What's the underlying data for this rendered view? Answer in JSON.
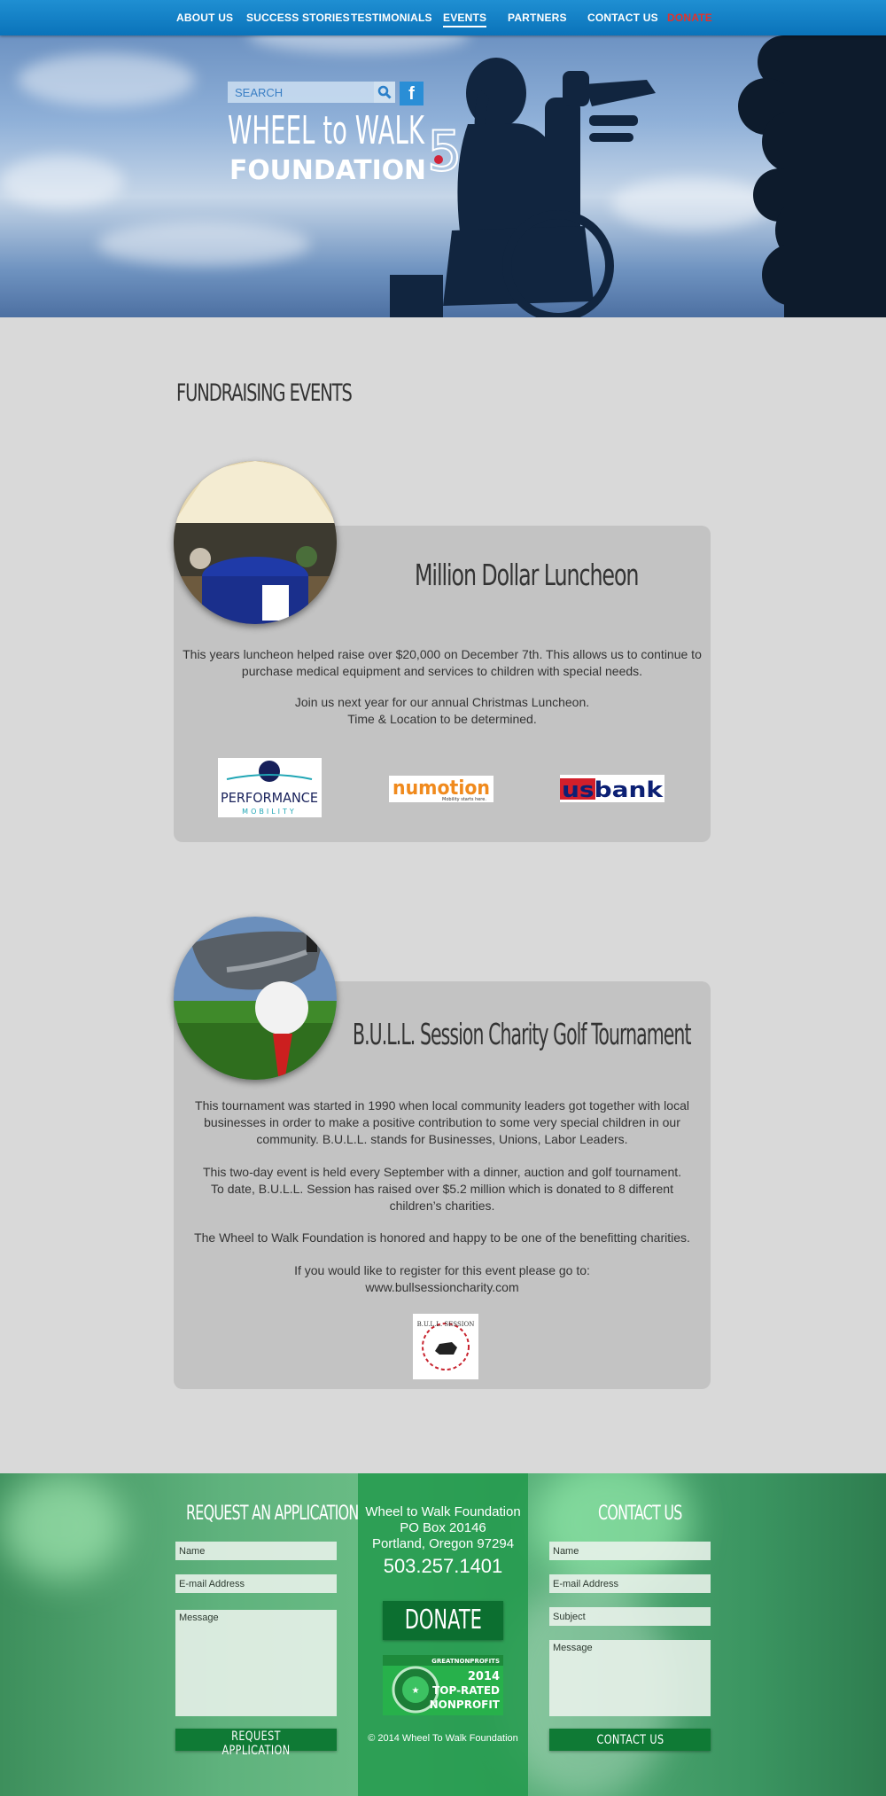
{
  "nav": {
    "items": [
      {
        "label": "ABOUT US"
      },
      {
        "label": "SUCCESS STORIES"
      },
      {
        "label": "TESTIMONIALS"
      },
      {
        "label": "EVENTS"
      },
      {
        "label": "PARTNERS"
      },
      {
        "label": "CONTACT US"
      },
      {
        "label": "DONATE"
      }
    ],
    "active": "EVENTS"
  },
  "header": {
    "search_placeholder": "SEARCH",
    "facebook_label": "f",
    "logo": {
      "line1": "WHEEL to WALK",
      "line2": "FOUNDATION",
      "mark": "5"
    }
  },
  "main": {
    "section_title": "FUNDRAISING EVENTS",
    "events": [
      {
        "title": "Million Dollar Luncheon",
        "paragraphs": [
          [
            "This years luncheon helped raise over $20,000 on December 7th. This allows us to continue to",
            "purchase medical equipment and services to children with special needs."
          ],
          [
            "Join us next year for our annual Christmas Luncheon.",
            "Time & Location to be determined."
          ]
        ],
        "sponsors": [
          {
            "name": "PERFORMANCE",
            "sub": "MOBILITY"
          },
          {
            "name": "numotion",
            "sub": "Mobility starts here."
          },
          {
            "name": "usbank"
          }
        ]
      },
      {
        "title": "B.U.L.L. Session Charity Golf Tournament",
        "paragraphs": [
          [
            "This tournament was started in 1990 when local community leaders got together with local",
            "businesses in order to make a positive contribution to some very special children in our",
            "community. B.U.L.L. stands for Businesses, Unions, Labor Leaders."
          ],
          [
            "This two-day event is held every September with a dinner, auction and golf tournament.",
            "To date, B.U.L.L. Session has raised over $5.2 million which is donated to 8 different",
            "children’s charities."
          ],
          [
            "The Wheel to Walk Foundation is honored and happy to be one of the benefitting charities."
          ],
          [
            "If you would like to register for this event please go to:",
            "www.bullsessioncharity.com"
          ]
        ],
        "sponsor": {
          "name": "B.U.L.L. SESSION"
        }
      }
    ]
  },
  "footer": {
    "request": {
      "heading": "REQUEST AN APPLICATION",
      "name_placeholder": "Name",
      "email_placeholder": "E-mail Address",
      "message_placeholder": "Message",
      "button": "REQUEST APPLICATION"
    },
    "center": {
      "org": "Wheel to Walk Foundation",
      "po_box": "PO Box 20146",
      "city": "Portland, Oregon 97294",
      "phone": "503.257.1401",
      "donate": "DONATE",
      "badge": {
        "brand": "GREATNONPROFITS",
        "year": "2014",
        "line1": "TOP-RATED",
        "line2": "NONPROFIT"
      },
      "copyright": "© 2014 Wheel To Walk Foundation"
    },
    "contact": {
      "heading": "CONTACT US",
      "name_placeholder": "Name",
      "email_placeholder": "E-mail Address",
      "subject_placeholder": "Subject",
      "message_placeholder": "Message",
      "button": "CONTACT US"
    }
  },
  "colors": {
    "nav_bar": "#1582c8",
    "donate_red": "#e4322b",
    "card_bg": "#c3c3c3",
    "page_bg": "#d9d9d9",
    "footer_green": "#20984b",
    "button_green": "#0f7a35"
  }
}
